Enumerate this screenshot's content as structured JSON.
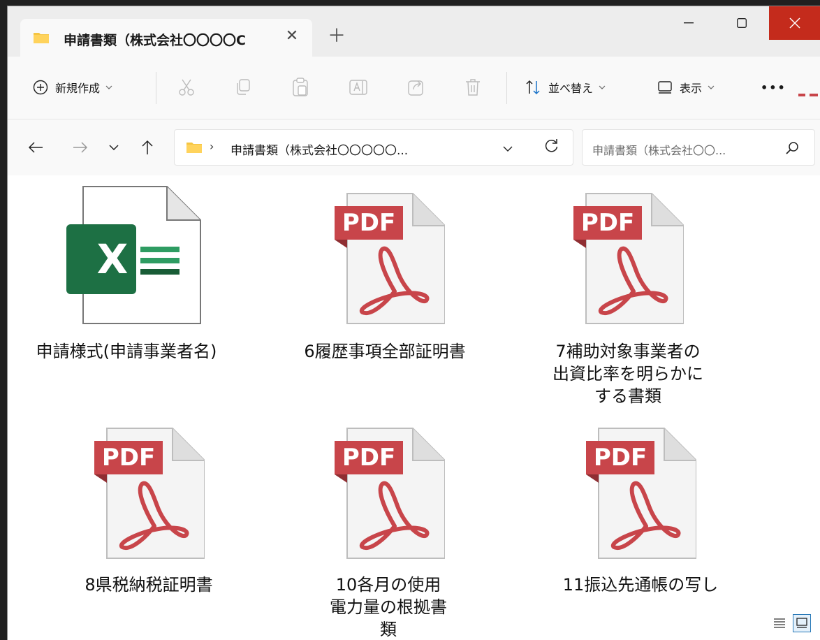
{
  "tab": {
    "title": "申請書類（株式会社〇〇〇〇C",
    "close": "✕",
    "new_tab": "＋"
  },
  "window_controls": {
    "minimize": "minimize",
    "maximize": "maximize",
    "close": "close"
  },
  "toolbar": {
    "new_label": "新規作成",
    "sort_label": "並べ替え",
    "view_label": "表示",
    "more": "•••"
  },
  "address": {
    "path": "申請書類（株式会社〇〇〇〇〇..."
  },
  "search": {
    "placeholder": "申請書類（株式会社〇〇..."
  },
  "files": [
    {
      "type": "excel",
      "name": "申請様式(申請事業者名)"
    },
    {
      "type": "pdf",
      "name": "6履歴事項全部証明書"
    },
    {
      "type": "pdf",
      "name": "7補助対象事業者の出資比率を明らかにする書類"
    },
    {
      "type": "pdf",
      "name": "8県税納税証明書"
    },
    {
      "type": "pdf",
      "name": "10各月の使用電力量の根拠書類"
    },
    {
      "type": "pdf",
      "name": "11振込先通帳の写し"
    }
  ],
  "pdf_badge": "PDF",
  "excel_badge": "X",
  "colors": {
    "pdf_red": "#c8454a",
    "excel_green": "#1d7044",
    "close_red": "#c42b1c",
    "folder_yellow": "#f5c542"
  }
}
